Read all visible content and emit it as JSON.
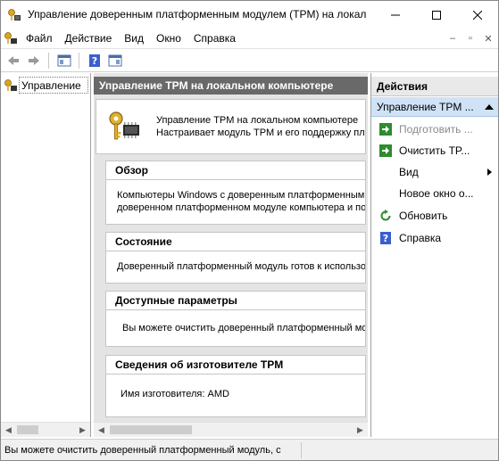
{
  "window": {
    "title": "Управление доверенным платформенным модулем (TPM) на локал..."
  },
  "menubar": {
    "items": [
      "Файл",
      "Действие",
      "Вид",
      "Окно",
      "Справка"
    ],
    "mdi_minimize": "–",
    "mdi_restore": "▫",
    "mdi_close": "✕"
  },
  "tree": {
    "item_label": "Управление"
  },
  "center": {
    "header": "Управление TPM на локальном компьютере",
    "intro_line1": "Управление TPM на локальном компьютере",
    "intro_line2": "Настраивает модуль TPM и его поддержку пл",
    "sections": [
      {
        "title": "Обзор",
        "lines": [
          "Компьютеры Windows с доверенным платформенным",
          "доверенном платформенном модуле компьютера и по"
        ]
      },
      {
        "title": "Состояние",
        "lines": [
          "Доверенный платформенный модуль готов к использо"
        ]
      },
      {
        "title": "Доступные параметры",
        "lines": [
          "Вы можете очистить доверенный платформенный мо"
        ]
      },
      {
        "title": "Сведения об изготовителе TPM",
        "lines": [
          "Имя изготовителя:  AMD"
        ]
      }
    ]
  },
  "actions": {
    "header": "Действия",
    "group_label": "Управление TPM ...",
    "items": [
      {
        "label": "Подготовить ...",
        "icon": "green-arrow-icon",
        "disabled": true
      },
      {
        "label": "Очистить TP...",
        "icon": "green-arrow-icon",
        "disabled": false
      },
      {
        "label": "Вид",
        "icon": "",
        "disabled": false,
        "submenu": true
      },
      {
        "label": "Новое окно о...",
        "icon": "",
        "disabled": false
      },
      {
        "label": "Обновить",
        "icon": "refresh-icon",
        "disabled": false
      },
      {
        "label": "Справка",
        "icon": "help-icon",
        "disabled": false
      }
    ]
  },
  "statusbar": {
    "text": "Вы можете очистить доверенный платформенный модуль, с"
  },
  "colors": {
    "header_bg": "#696969",
    "selected_action_bg": "#cfe2f6",
    "pane_bg": "#e4e4e4"
  }
}
